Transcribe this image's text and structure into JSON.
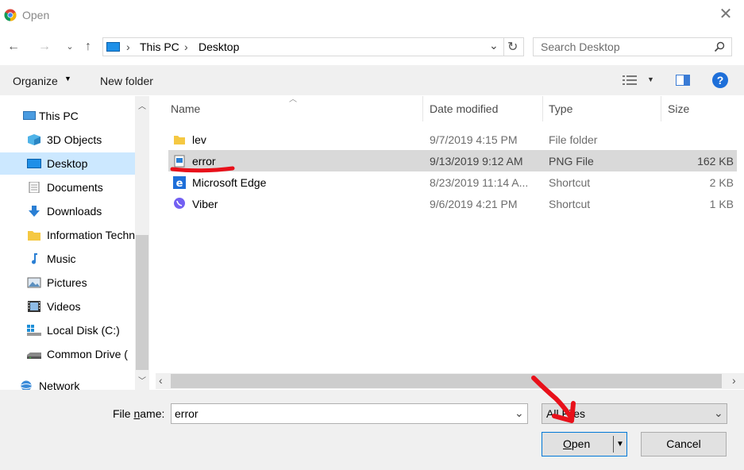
{
  "window": {
    "title": "Open"
  },
  "address": {
    "segments": [
      "This PC",
      "Desktop"
    ]
  },
  "search": {
    "placeholder": "Search Desktop"
  },
  "toolbar": {
    "organize_label": "Organize",
    "new_folder_label": "New folder"
  },
  "sidebar": {
    "items": [
      {
        "label": "This PC",
        "icon": "computer-icon"
      },
      {
        "label": "3D Objects",
        "icon": "cube-icon"
      },
      {
        "label": "Desktop",
        "icon": "desktop-icon"
      },
      {
        "label": "Documents",
        "icon": "document-icon"
      },
      {
        "label": "Downloads",
        "icon": "download-icon"
      },
      {
        "label": "Information Techn",
        "icon": "folder-icon"
      },
      {
        "label": "Music",
        "icon": "music-icon"
      },
      {
        "label": "Pictures",
        "icon": "picture-icon"
      },
      {
        "label": "Videos",
        "icon": "video-icon"
      },
      {
        "label": "Local Disk (C:)",
        "icon": "drive-icon"
      },
      {
        "label": "Common Drive (",
        "icon": "network-drive-icon"
      },
      {
        "label": "Network",
        "icon": "network-icon"
      }
    ]
  },
  "columns": {
    "name": "Name",
    "date": "Date modified",
    "type": "Type",
    "size": "Size"
  },
  "files": [
    {
      "name": "lev",
      "date": "9/7/2019 4:15 PM",
      "type": "File folder",
      "size": "",
      "icon": "folder-icon"
    },
    {
      "name": "error",
      "date": "9/13/2019 9:12 AM",
      "type": "PNG File",
      "size": "162 KB",
      "icon": "image-file-icon"
    },
    {
      "name": "Microsoft Edge",
      "date": "8/23/2019 11:14 A...",
      "type": "Shortcut",
      "size": "2 KB",
      "icon": "edge-icon"
    },
    {
      "name": "Viber",
      "date": "9/6/2019 4:21 PM",
      "type": "Shortcut",
      "size": "1 KB",
      "icon": "viber-icon"
    }
  ],
  "footer": {
    "filename_label_pre": "File ",
    "filename_label_u": "n",
    "filename_label_post": "ame:",
    "filename_value": "error",
    "filter_value": "All Files",
    "open_label_u": "O",
    "open_label_rest": "pen",
    "cancel_label": "Cancel"
  },
  "colors": {
    "selected_row": "#d9d9d9",
    "annotation_red": "#e8101a",
    "help_blue": "#1e6fd9"
  }
}
